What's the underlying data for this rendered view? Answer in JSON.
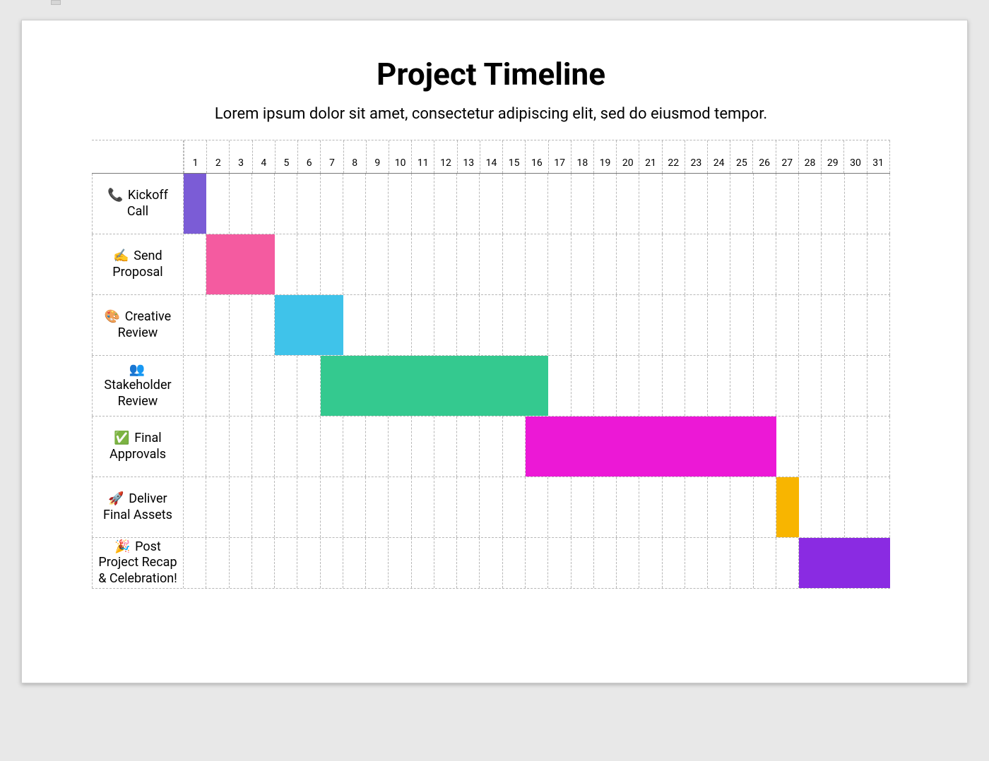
{
  "title": "Project Timeline",
  "subtitle": "Lorem ipsum dolor sit amet, consectetur adipiscing elit, sed do eiusmod tempor.",
  "chart_data": {
    "type": "bar",
    "orientation": "gantt",
    "xlabel": "",
    "ylabel": "",
    "title": "Project Timeline",
    "xlim": [
      1,
      31
    ],
    "days": [
      "1",
      "2",
      "3",
      "4",
      "5",
      "6",
      "7",
      "8",
      "9",
      "10",
      "11",
      "12",
      "13",
      "14",
      "15",
      "16",
      "17",
      "18",
      "19",
      "20",
      "21",
      "22",
      "23",
      "24",
      "25",
      "26",
      "27",
      "28",
      "29",
      "30",
      "31"
    ],
    "tasks": [
      {
        "icon": "📞",
        "label": "Kickoff Call",
        "start": 1,
        "end": 1,
        "color": "#7b5cd6"
      },
      {
        "icon": "✍️",
        "label": "Send Proposal",
        "start": 2,
        "end": 4,
        "color": "#f45ba0"
      },
      {
        "icon": "🎨",
        "label": "Creative Review",
        "start": 5,
        "end": 7,
        "color": "#3fc3ea"
      },
      {
        "icon": "👥",
        "label": "Stakeholder Review",
        "start": 7,
        "end": 16,
        "color": "#34c98f"
      },
      {
        "icon": "✅",
        "label": "Final Approvals",
        "start": 16,
        "end": 26,
        "color": "#ec18d6"
      },
      {
        "icon": "🚀",
        "label": "Deliver Final Assets",
        "start": 27,
        "end": 27,
        "color": "#f8b500"
      },
      {
        "icon": "🎉",
        "label": "Post Project Recap & Celebration!",
        "start": 28,
        "end": 31,
        "color": "#8a2be2"
      }
    ]
  }
}
